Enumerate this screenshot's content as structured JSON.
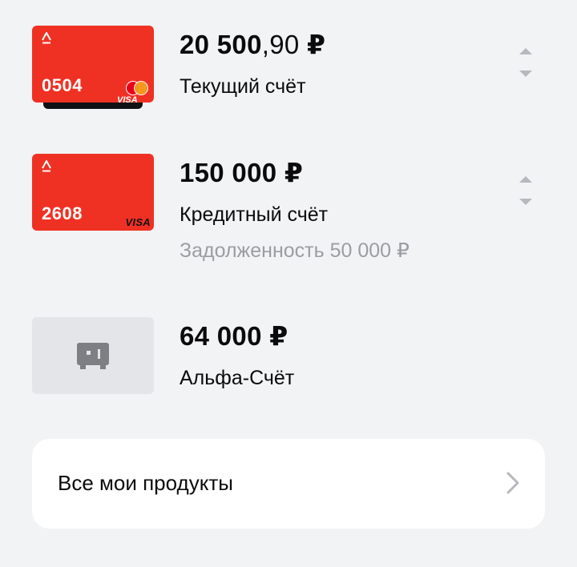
{
  "accounts": [
    {
      "card_number": "0504",
      "card_network": "mastercard-logo",
      "card_network_secondary": "VISA",
      "amount_main": "20 500",
      "amount_fraction": ",90",
      "currency": "₽",
      "name": "Текущий счёт"
    },
    {
      "card_number": "2608",
      "card_network": "VISA",
      "amount_main": "150 000",
      "amount_fraction": "",
      "currency": "₽",
      "name": "Кредитный счёт",
      "note": "Задолженность 50 000 ₽"
    },
    {
      "icon": "safe-icon",
      "amount_main": "64 000",
      "amount_fraction": "",
      "currency": "₽",
      "name": "Альфа-Счёт"
    }
  ],
  "all_products": {
    "label": "Все мои продукты",
    "icon": "chevron-right-icon"
  },
  "colors": {
    "background": "#f2f3f5",
    "card_red": "#ef3124",
    "muted_text": "#9c9da2",
    "handle_gray": "#b7b8bd"
  }
}
